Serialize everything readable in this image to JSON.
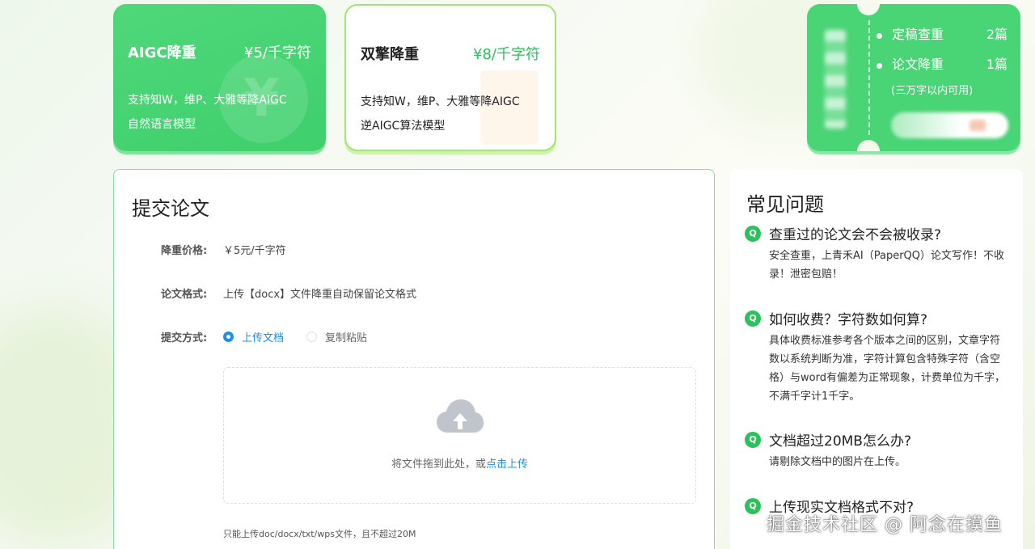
{
  "cards": [
    {
      "name": "AIGC降重",
      "price": "¥5/千字符",
      "desc_line1": "支持知W，维P、大雅等降AIGC",
      "desc_line2": "自然语言模型"
    },
    {
      "name": "双擎降重",
      "price": "¥8/千字符",
      "desc_line1": "支持知W，维P、大雅等降AIGC",
      "desc_line2": "逆AIGC算法模型"
    }
  ],
  "coupon": {
    "items": [
      {
        "label": "定稿查重",
        "count": "2篇"
      },
      {
        "label": "论文降重",
        "count": "1篇"
      }
    ],
    "note": "(三万字以内可用)"
  },
  "submit": {
    "title": "提交论文",
    "price_label": "降重价格:",
    "price_value": "￥5元/千字符",
    "format_label": "论文格式:",
    "format_value": "上传【docx】文件降重自动保留论文格式",
    "method_label": "提交方式:",
    "method_options": [
      "上传文档",
      "复制粘贴"
    ],
    "method_selected": "上传文档",
    "upload_text": "将文件拖到此处，或",
    "upload_link": "点击上传",
    "upload_tip": "只能上传doc/docx/txt/wps文件，且不超过20M"
  },
  "faq": {
    "title": "常见问题",
    "items": [
      {
        "q": "查重过的论文会不会被收录?",
        "a": "安全查重，上青禾AI（PaperQQ）论文写作！不收录！泄密包赔！"
      },
      {
        "q": "如何收费？字符数如何算?",
        "a": "具体收费标准参考各个版本之间的区别，文章字符数以系统判断为准，字符计算包含特殊字符（含空格）与word有偏差为正常现象，计费单位为千字，不满千字计1千字。"
      },
      {
        "q": "文档超过20MB怎么办?",
        "a": "请剔除文档中的图片在上传。"
      },
      {
        "q": "上传现实文档格式不对?",
        "a": ""
      }
    ]
  },
  "watermark": "掘金技术社区 @ 阿念在摸鱼",
  "colors": {
    "accent_green": "#3fcf6c",
    "link_blue": "#1d8fe8"
  }
}
